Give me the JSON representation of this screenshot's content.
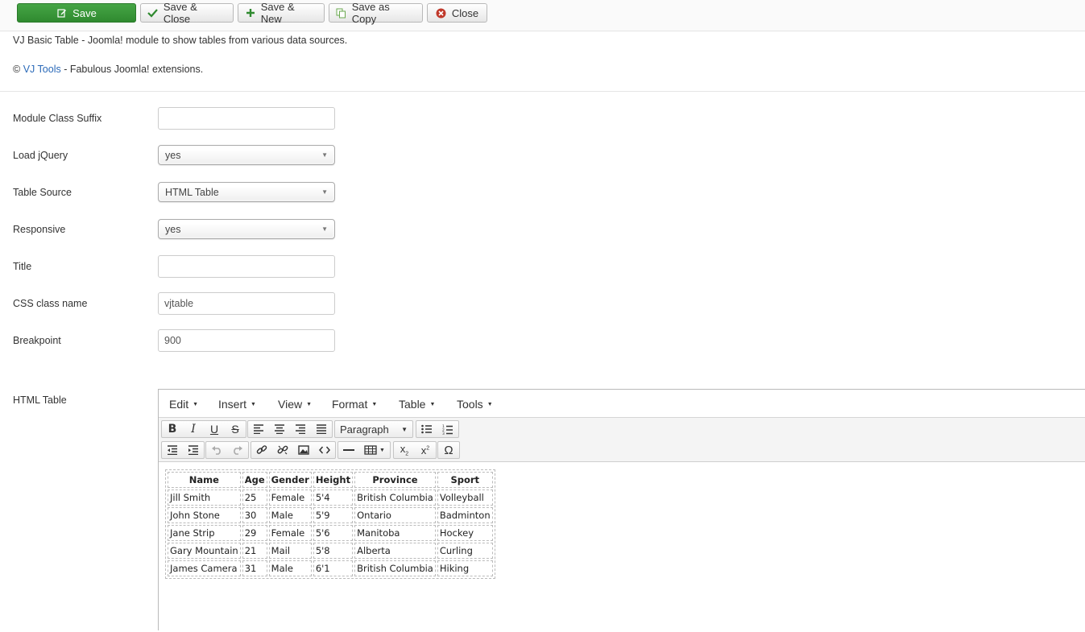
{
  "toolbar": {
    "save": "Save",
    "save_close": "Save & Close",
    "save_new": "Save & New",
    "save_copy": "Save as Copy",
    "close": "Close"
  },
  "description": {
    "line1": "VJ Basic Table - Joomla! module to show tables from various data sources.",
    "copyright": "©",
    "link_text": "VJ Tools",
    "line2_rest": "- Fabulous Joomla! extensions."
  },
  "form": {
    "module_class_suffix": {
      "label": "Module Class Suffix",
      "value": ""
    },
    "load_jquery": {
      "label": "Load jQuery",
      "value": "yes"
    },
    "table_source": {
      "label": "Table Source",
      "value": "HTML Table"
    },
    "responsive": {
      "label": "Responsive",
      "value": "yes"
    },
    "title": {
      "label": "Title",
      "value": ""
    },
    "css_class": {
      "label": "CSS class name",
      "value": "vjtable"
    },
    "breakpoint": {
      "label": "Breakpoint",
      "value": "900"
    },
    "html_table": {
      "label": "HTML Table"
    }
  },
  "editor": {
    "menus": [
      "Edit",
      "Insert",
      "View",
      "Format",
      "Table",
      "Tools"
    ],
    "format_select": "Paragraph",
    "table": {
      "headers": [
        "Name",
        "Age",
        "Gender",
        "Height",
        "Province",
        "Sport"
      ],
      "rows": [
        [
          "Jill Smith",
          "25",
          "Female",
          "5'4",
          "British Columbia",
          "Volleyball"
        ],
        [
          "John Stone",
          "30",
          "Male",
          "5'9",
          "Ontario",
          "Badminton"
        ],
        [
          "Jane Strip",
          "29",
          "Female",
          "5'6",
          "Manitoba",
          "Hockey"
        ],
        [
          "Gary Mountain",
          "21",
          "Mail",
          "5'8",
          "Alberta",
          "Curling"
        ],
        [
          "James Camera",
          "31",
          "Male",
          "6'1",
          "British Columbia",
          "Hiking"
        ]
      ]
    }
  },
  "colors": {
    "primary_button": "#3a9a3a",
    "link": "#2a69b8",
    "close_icon": "#c0392b"
  }
}
